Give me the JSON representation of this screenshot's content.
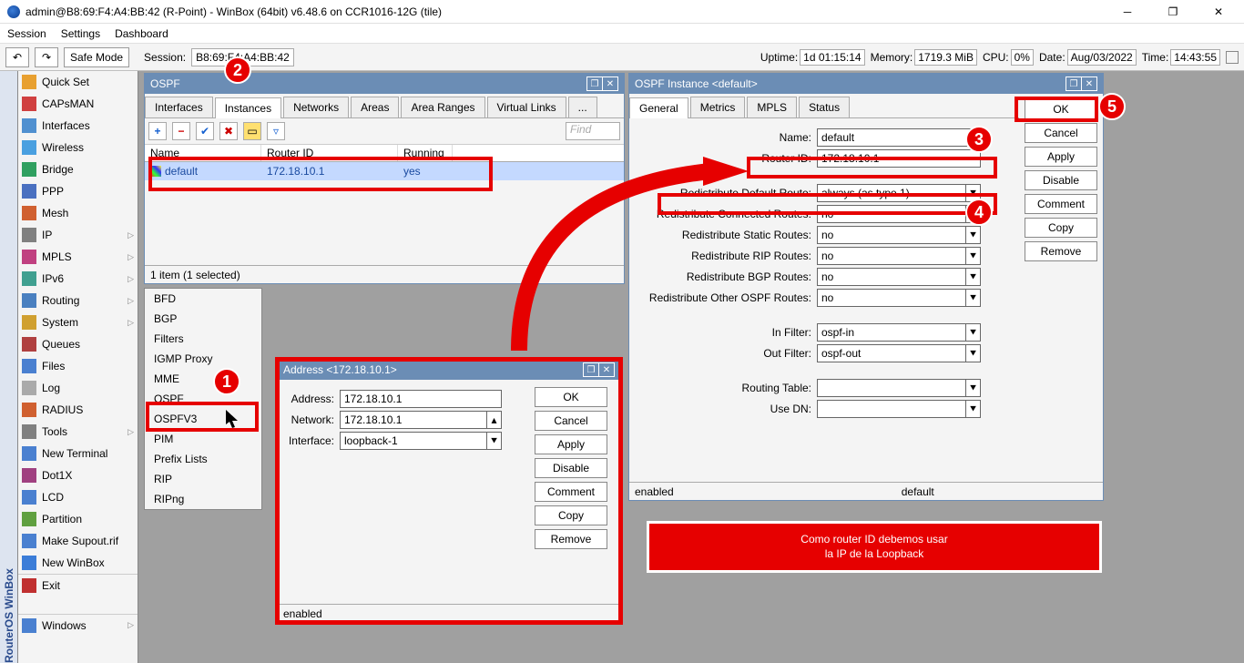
{
  "title": "admin@B8:69:F4:A4:BB:42 (R-Point) - WinBox (64bit) v6.48.6 on CCR1016-12G (tile)",
  "menu": {
    "session": "Session",
    "settings": "Settings",
    "dashboard": "Dashboard"
  },
  "toolbar": {
    "safe_mode": "Safe Mode",
    "session_lbl": "Session:",
    "session_val": "B8:69:F4:A4:BB:42"
  },
  "status": {
    "uptime_lbl": "Uptime:",
    "uptime": "1d 01:15:14",
    "mem_lbl": "Memory:",
    "mem": "1719.3 MiB",
    "cpu_lbl": "CPU:",
    "cpu": "0%",
    "date_lbl": "Date:",
    "date": "Aug/03/2022",
    "time_lbl": "Time:",
    "time": "14:43:55"
  },
  "side_label": "RouterOS WinBox",
  "sidebar": [
    {
      "label": "Quick Set",
      "icon": "#e8a030"
    },
    {
      "label": "CAPsMAN",
      "icon": "#d04040"
    },
    {
      "label": "Interfaces",
      "icon": "#5090d0"
    },
    {
      "label": "Wireless",
      "icon": "#4aa0e0"
    },
    {
      "label": "Bridge",
      "icon": "#30a060"
    },
    {
      "label": "PPP",
      "icon": "#4a70c0"
    },
    {
      "label": "Mesh",
      "icon": "#d06030"
    },
    {
      "label": "IP",
      "icon": "#808080",
      "arrow": true
    },
    {
      "label": "MPLS",
      "icon": "#c04080",
      "arrow": true
    },
    {
      "label": "IPv6",
      "icon": "#40a090",
      "arrow": true
    },
    {
      "label": "Routing",
      "icon": "#4a80c0",
      "arrow": true
    },
    {
      "label": "System",
      "icon": "#d0a030",
      "arrow": true
    },
    {
      "label": "Queues",
      "icon": "#b04040"
    },
    {
      "label": "Files",
      "icon": "#4a80d0"
    },
    {
      "label": "Log",
      "icon": "#aaaaaa"
    },
    {
      "label": "RADIUS",
      "icon": "#d06030"
    },
    {
      "label": "Tools",
      "icon": "#808080",
      "arrow": true
    },
    {
      "label": "New Terminal",
      "icon": "#4a80d0"
    },
    {
      "label": "Dot1X",
      "icon": "#a04080"
    },
    {
      "label": "LCD",
      "icon": "#4a80d0"
    },
    {
      "label": "Partition",
      "icon": "#60a040"
    },
    {
      "label": "Make Supout.rif",
      "icon": "#4a80d0"
    },
    {
      "label": "New WinBox",
      "icon": "#3b7dd8"
    },
    {
      "label": "Exit",
      "icon": "#c03030"
    },
    {
      "label": "Windows",
      "icon": "#4a80d0",
      "arrow": true
    }
  ],
  "ospf_win": {
    "title": "OSPF",
    "tabs": [
      "Interfaces",
      "Instances",
      "Networks",
      "Areas",
      "Area Ranges",
      "Virtual Links",
      "..."
    ],
    "active_tab": 1,
    "find": "Find",
    "cols": {
      "name": "Name",
      "router_id": "Router ID",
      "running": "Running"
    },
    "row": {
      "name": "default",
      "router_id": "172.18.10.1",
      "running": "yes"
    },
    "status": "1 item (1 selected)"
  },
  "routing_menu": [
    "BFD",
    "BGP",
    "Filters",
    "IGMP Proxy",
    "MME",
    "OSPF",
    "OSPFV3",
    "PIM",
    "Prefix Lists",
    "RIP",
    "RIPng"
  ],
  "addr_win": {
    "title": "Address <172.18.10.1>",
    "labels": {
      "address": "Address:",
      "network": "Network:",
      "interface": "Interface:"
    },
    "vals": {
      "address": "172.18.10.1",
      "network": "172.18.10.1",
      "interface": "loopback-1"
    },
    "btns": {
      "ok": "OK",
      "cancel": "Cancel",
      "apply": "Apply",
      "disable": "Disable",
      "comment": "Comment",
      "copy": "Copy",
      "remove": "Remove"
    },
    "status": "enabled"
  },
  "instance_win": {
    "title": "OSPF Instance <default>",
    "tabs": [
      "General",
      "Metrics",
      "MPLS",
      "Status"
    ],
    "active_tab": 0,
    "fields": {
      "name": {
        "lbl": "Name:",
        "val": "default"
      },
      "router_id": {
        "lbl": "Router ID:",
        "val": "172.18.10.1"
      },
      "redist_def": {
        "lbl": "Redistribute Default Route:",
        "val": "always (as type 1)"
      },
      "redist_conn": {
        "lbl": "Redistribute Connected Routes:",
        "val": "no"
      },
      "redist_static": {
        "lbl": "Redistribute Static Routes:",
        "val": "no"
      },
      "redist_rip": {
        "lbl": "Redistribute RIP Routes:",
        "val": "no"
      },
      "redist_bgp": {
        "lbl": "Redistribute BGP Routes:",
        "val": "no"
      },
      "redist_other": {
        "lbl": "Redistribute Other OSPF Routes:",
        "val": "no"
      },
      "in_filter": {
        "lbl": "In Filter:",
        "val": "ospf-in"
      },
      "out_filter": {
        "lbl": "Out Filter:",
        "val": "ospf-out"
      },
      "routing_table": {
        "lbl": "Routing Table:",
        "val": ""
      },
      "use_dn": {
        "lbl": "Use DN:",
        "val": ""
      }
    },
    "btns": {
      "ok": "OK",
      "cancel": "Cancel",
      "apply": "Apply",
      "disable": "Disable",
      "comment": "Comment",
      "copy": "Copy",
      "remove": "Remove"
    },
    "status_l": "enabled",
    "status_r": "default"
  },
  "annotation": "Como router ID debemos usar\nla IP de la Loopback",
  "markers": {
    "1": "1",
    "2": "2",
    "3": "3",
    "4": "4",
    "5": "5"
  }
}
